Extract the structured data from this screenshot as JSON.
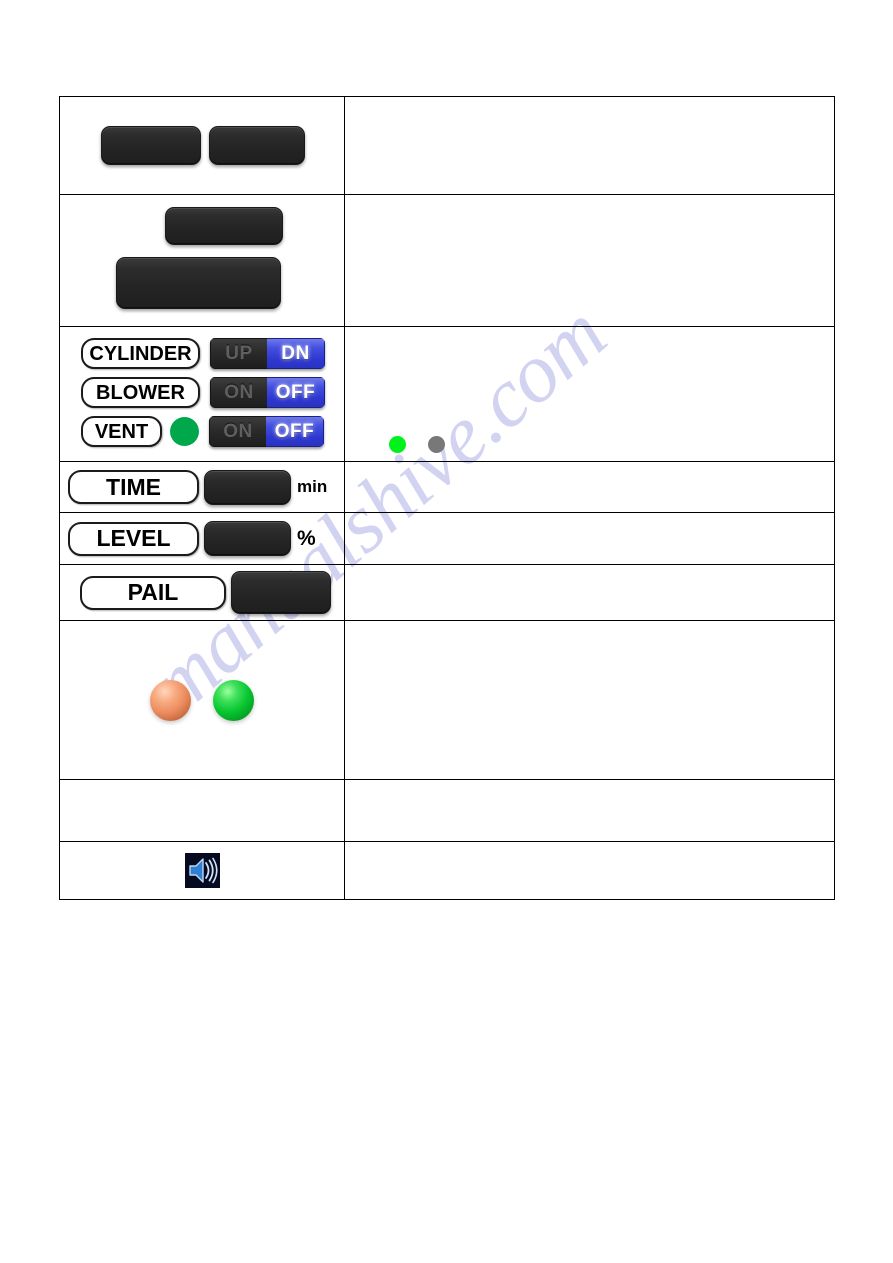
{
  "watermark": {
    "text": "manualshive.com"
  },
  "table": {
    "rows": [
      {
        "id": "row-buttons-pair",
        "left": {
          "type": "button-pair",
          "buttons": [
            {
              "name": "display-button-1",
              "label": ""
            },
            {
              "name": "display-button-2",
              "label": ""
            }
          ]
        },
        "right": {
          "text": ""
        }
      },
      {
        "id": "row-buttons-stacked",
        "left": {
          "type": "button-stack",
          "buttons": [
            {
              "name": "display-button-3",
              "label": ""
            },
            {
              "name": "display-button-4",
              "label": ""
            }
          ]
        },
        "right": {
          "text": ""
        }
      },
      {
        "id": "row-controls",
        "left": {
          "type": "controls",
          "controls": [
            {
              "name": "cylinder",
              "label": "CYLINDER",
              "has_led": false,
              "toggle": {
                "off_label": "UP",
                "on_label": "DN",
                "active": "DN"
              }
            },
            {
              "name": "blower",
              "label": "BLOWER",
              "has_led": false,
              "toggle": {
                "off_label": "ON",
                "on_label": "OFF",
                "active": "OFF"
              }
            },
            {
              "name": "vent",
              "label": "VENT",
              "has_led": true,
              "led_color": "#00a84b",
              "toggle": {
                "off_label": "ON",
                "on_label": "OFF",
                "active": "OFF"
              }
            }
          ]
        },
        "right": {
          "text": "",
          "dots": [
            {
              "name": "status-dot-green",
              "color": "#00f21c"
            },
            {
              "name": "status-dot-grey",
              "color": "#787878"
            }
          ]
        }
      },
      {
        "id": "row-time",
        "left": {
          "type": "value",
          "label": "TIME",
          "value": "",
          "unit": "min"
        },
        "right": {
          "text": ""
        }
      },
      {
        "id": "row-level",
        "left": {
          "type": "value",
          "label": "LEVEL",
          "value": "",
          "unit": "%"
        },
        "right": {
          "text": ""
        }
      },
      {
        "id": "row-pail",
        "left": {
          "type": "value",
          "label": "PAIL",
          "value": "",
          "unit": ""
        },
        "right": {
          "text": ""
        }
      },
      {
        "id": "row-lamps",
        "left": {
          "type": "lamps",
          "lamps": [
            {
              "name": "indicator-lamp-amber",
              "color": "#ea8b5e"
            },
            {
              "name": "indicator-lamp-green",
              "color": "#08c630"
            }
          ]
        },
        "right": {
          "text": ""
        }
      },
      {
        "id": "row-blank",
        "left": {
          "type": "blank"
        },
        "right": {
          "text": ""
        }
      },
      {
        "id": "row-speaker",
        "left": {
          "type": "icon",
          "icon": "speaker-icon"
        },
        "right": {
          "text": ""
        }
      }
    ]
  }
}
